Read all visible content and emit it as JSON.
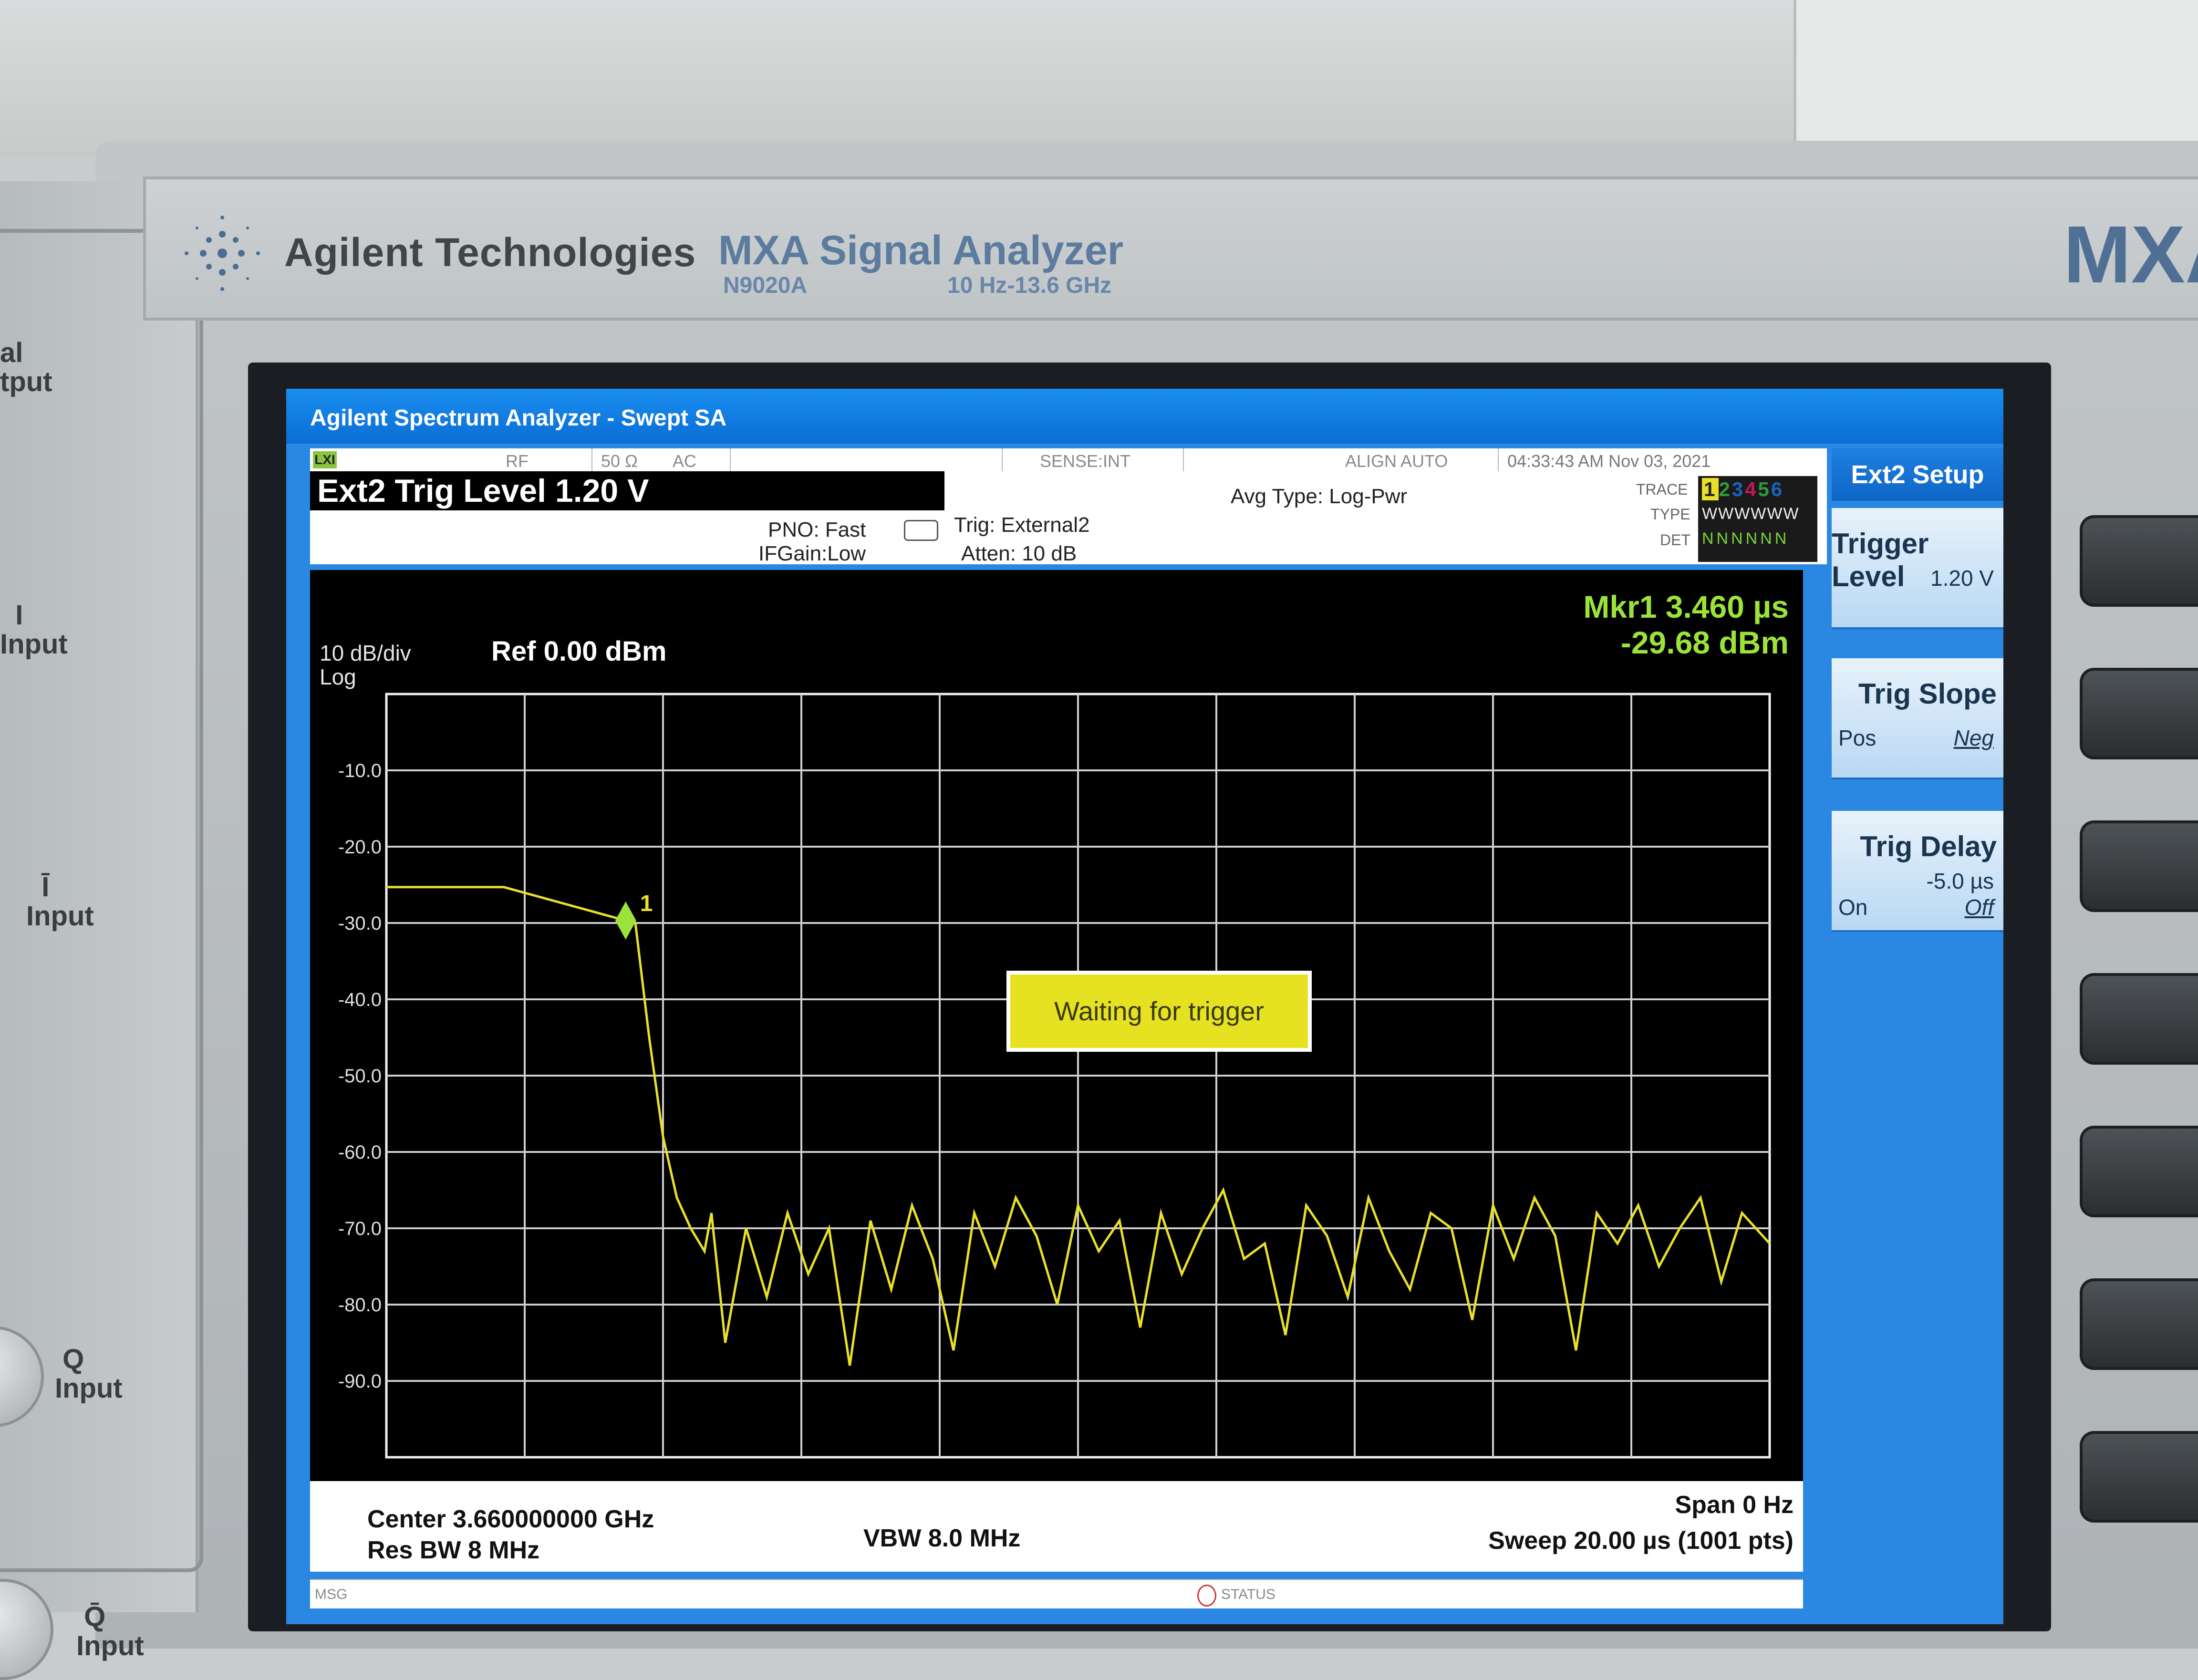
{
  "device": {
    "brand": "Agilent Technologies",
    "model_title": "MXA Signal Analyzer",
    "model_number": "N9020A",
    "freq_range": "10 Hz-13.6 GHz",
    "model_short": "MXA"
  },
  "front_panel": {
    "labels": [
      "al\ntput",
      "I\nInput",
      "Ī\nInput",
      "Q\nInput",
      "Q̄\nInput"
    ]
  },
  "screen": {
    "title": "Agilent Spectrum Analyzer - Swept SA",
    "status": {
      "lxi": "LXI",
      "rf": "RF",
      "impedance": "50 Ω",
      "coupling": "AC",
      "sense": "SENSE:INT",
      "align": "ALIGN AUTO",
      "datetime": "04:33:43 AM Nov 03, 2021"
    },
    "active_function": "Ext2 Trig Level 1.20 V",
    "pno": "PNO: Fast",
    "ifgain": "IFGain:Low",
    "trig": "Trig: External2",
    "atten": "Atten: 10 dB",
    "avg_type": "Avg Type: Log-Pwr",
    "trace": {
      "trace_label": "TRACE",
      "type_label": "TYPE",
      "det_label": "DET",
      "numbers": [
        "1",
        "2",
        "3",
        "4",
        "5",
        "6"
      ],
      "number_colors": [
        "#c8a400",
        "#2e9b3a",
        "#1565c0",
        "#c2185b",
        "#2e9b3a",
        "#1565c0"
      ],
      "type_row": "WWWWWW",
      "det_row": "NNNNNN"
    },
    "marker": {
      "line1": "Mkr1 3.460 µs",
      "line2": "-29.68 dBm",
      "label": "1",
      "color": "#9be33a"
    },
    "scale": "10 dB/div",
    "scale_type": "Log",
    "ref": "Ref 0.00 dBm",
    "waiting": "Waiting for trigger",
    "bottom": {
      "center": "Center 3.660000000 GHz",
      "res_bw": "Res BW 8 MHz",
      "vbw": "VBW 8.0 MHz",
      "span": "Span 0 Hz",
      "sweep": "Sweep  20.00 µs (1001 pts)"
    },
    "msg": "MSG",
    "status_label": "STATUS",
    "softkeys": {
      "title": "Ext2 Setup",
      "trigger_level": "Trigger Level",
      "trigger_level_val": "1.20 V",
      "trig_slope": "Trig Slope",
      "slope_pos": "Pos",
      "slope_neg": "Neg",
      "trig_delay": "Trig Delay",
      "trig_delay_val": "-5.0 µs",
      "delay_on": "On",
      "delay_off": "Off"
    }
  },
  "chart_data": {
    "type": "line",
    "ylabel": "",
    "xlabel": "",
    "y_ticks": [
      "-10.0",
      "-20.0",
      "-30.0",
      "-40.0",
      "-50.0",
      "-60.0",
      "-70.0",
      "-80.0",
      "-90.0"
    ],
    "ylim": [
      -100,
      0
    ],
    "xlim": [
      0,
      20
    ],
    "grid": true,
    "series": [
      {
        "color": "#e8e02a",
        "x": [
          0,
          1.7,
          3.46,
          3.6,
          3.8,
          4.0,
          4.2,
          4.4,
          4.6,
          4.7,
          4.9,
          5.2,
          5.5,
          5.8,
          6.1,
          6.4,
          6.7,
          7.0,
          7.3,
          7.6,
          7.9,
          8.2,
          8.5,
          8.8,
          9.1,
          9.4,
          9.7,
          10.0,
          10.3,
          10.6,
          10.9,
          11.2,
          11.5,
          11.8,
          12.1,
          12.4,
          12.7,
          13.0,
          13.3,
          13.6,
          13.9,
          14.2,
          14.5,
          14.8,
          15.1,
          15.4,
          15.7,
          16.0,
          16.3,
          16.6,
          16.9,
          17.2,
          17.5,
          17.8,
          18.1,
          18.4,
          18.7,
          19.0,
          19.3,
          19.6,
          20.0
        ],
        "y": [
          -25.3,
          -25.3,
          -29.68,
          -30.0,
          -45.0,
          -58.0,
          -66.0,
          -70.0,
          -73.0,
          -68.0,
          -85.0,
          -70.0,
          -79.0,
          -68.0,
          -76.0,
          -70.0,
          -88.0,
          -69.0,
          -78.0,
          -67.0,
          -74.0,
          -86.0,
          -68.0,
          -75.0,
          -66.0,
          -71.0,
          -80.0,
          -67.0,
          -73.0,
          -69.0,
          -83.0,
          -68.0,
          -76.0,
          -70.0,
          -65.0,
          -74.0,
          -72.0,
          -84.0,
          -67.0,
          -71.0,
          -79.0,
          -66.0,
          -73.0,
          -78.0,
          -68.0,
          -70.0,
          -82.0,
          -67.0,
          -74.0,
          -66.0,
          -71.0,
          -86.0,
          -68.0,
          -72.0,
          -67.0,
          -75.0,
          -70.0,
          -66.0,
          -77.0,
          -68.0,
          -72.0
        ]
      }
    ]
  }
}
